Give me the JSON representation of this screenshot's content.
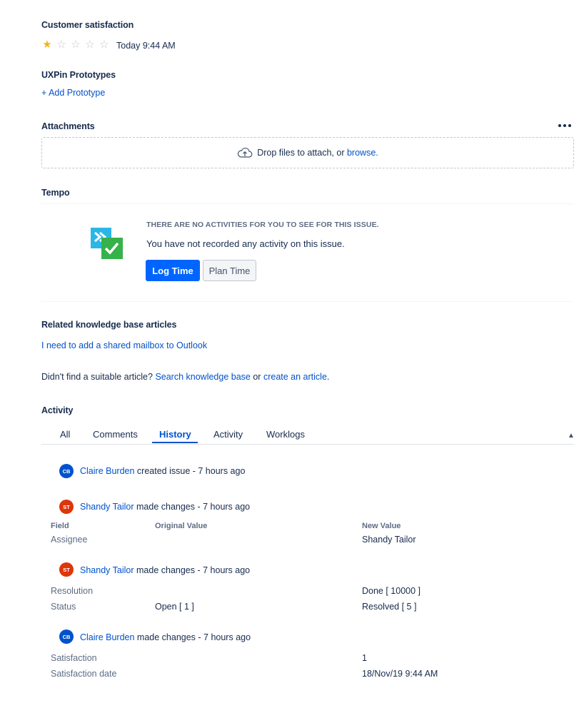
{
  "customer_satisfaction": {
    "title": "Customer satisfaction",
    "rating": 1,
    "max_rating": 5,
    "timestamp": "Today 9:44 AM",
    "colors": {
      "star_on": "#f2b418",
      "star_off": "#c1c7d0"
    }
  },
  "uxpin": {
    "title": "UXPin Prototypes",
    "add_link": "+ Add Prototype"
  },
  "attachments": {
    "title": "Attachments",
    "drop_text": "Drop files to attach, or",
    "browse_link": "browse",
    "browse_suffix": ".",
    "icons": {
      "more": "more-icon",
      "upload": "cloud-upload-icon"
    }
  },
  "tempo": {
    "title": "Tempo",
    "heading": "THERE ARE NO ACTIVITIES FOR YOU TO SEE FOR THIS ISSUE.",
    "message": "You have not recorded any activity on this issue.",
    "log_time_button": "Log Time",
    "plan_time_button": "Plan Time",
    "icon": "tempo-logo-icon"
  },
  "knowledge_base": {
    "title": "Related knowledge base articles",
    "article_link": "I need to add a shared mailbox to Outlook",
    "not_found_text": "Didn't find a suitable article?",
    "search_link": "Search knowledge base",
    "or_text": "or",
    "create_link": "create an article",
    "end_period": "."
  },
  "activity": {
    "title": "Activity",
    "tabs": [
      {
        "label": "All",
        "active": false
      },
      {
        "label": "Comments",
        "active": false
      },
      {
        "label": "History",
        "active": true
      },
      {
        "label": "Activity",
        "active": false
      },
      {
        "label": "Worklogs",
        "active": false
      }
    ],
    "collapse_icon": "chevron-up-icon",
    "table_headers": {
      "field": "Field",
      "original": "Original Value",
      "new": "New Value"
    },
    "history": [
      {
        "initials": "CB",
        "user": "Claire Burden",
        "action": "created issue - 7 hours ago",
        "avatar_color": "#0052cc",
        "rows": []
      },
      {
        "initials": "ST",
        "user": "Shandy Tailor",
        "action": "made changes - 7 hours ago",
        "avatar_color": "#de350b",
        "rows": [
          {
            "field": "Assignee",
            "original": "",
            "new": "Shandy Tailor"
          }
        ]
      },
      {
        "initials": "ST",
        "user": "Shandy Tailor",
        "action": "made changes - 7 hours ago",
        "avatar_color": "#de350b",
        "rows": [
          {
            "field": "Resolution",
            "original": "",
            "new": "Done [ 10000 ]"
          },
          {
            "field": "Status",
            "original": "Open [ 1 ]",
            "new": "Resolved [ 5 ]"
          }
        ]
      },
      {
        "initials": "CB",
        "user": "Claire Burden",
        "action": "made changes - 7 hours ago",
        "avatar_color": "#0052cc",
        "rows": [
          {
            "field": "Satisfaction",
            "original": "",
            "new": "1"
          },
          {
            "field": "Satisfaction date",
            "original": "",
            "new": "18/Nov/19 9:44 AM"
          }
        ]
      }
    ]
  },
  "colors": {
    "link": "#0052cc",
    "text": "#172b4d",
    "muted": "#5e6c84",
    "primary_button": "#0065ff"
  }
}
